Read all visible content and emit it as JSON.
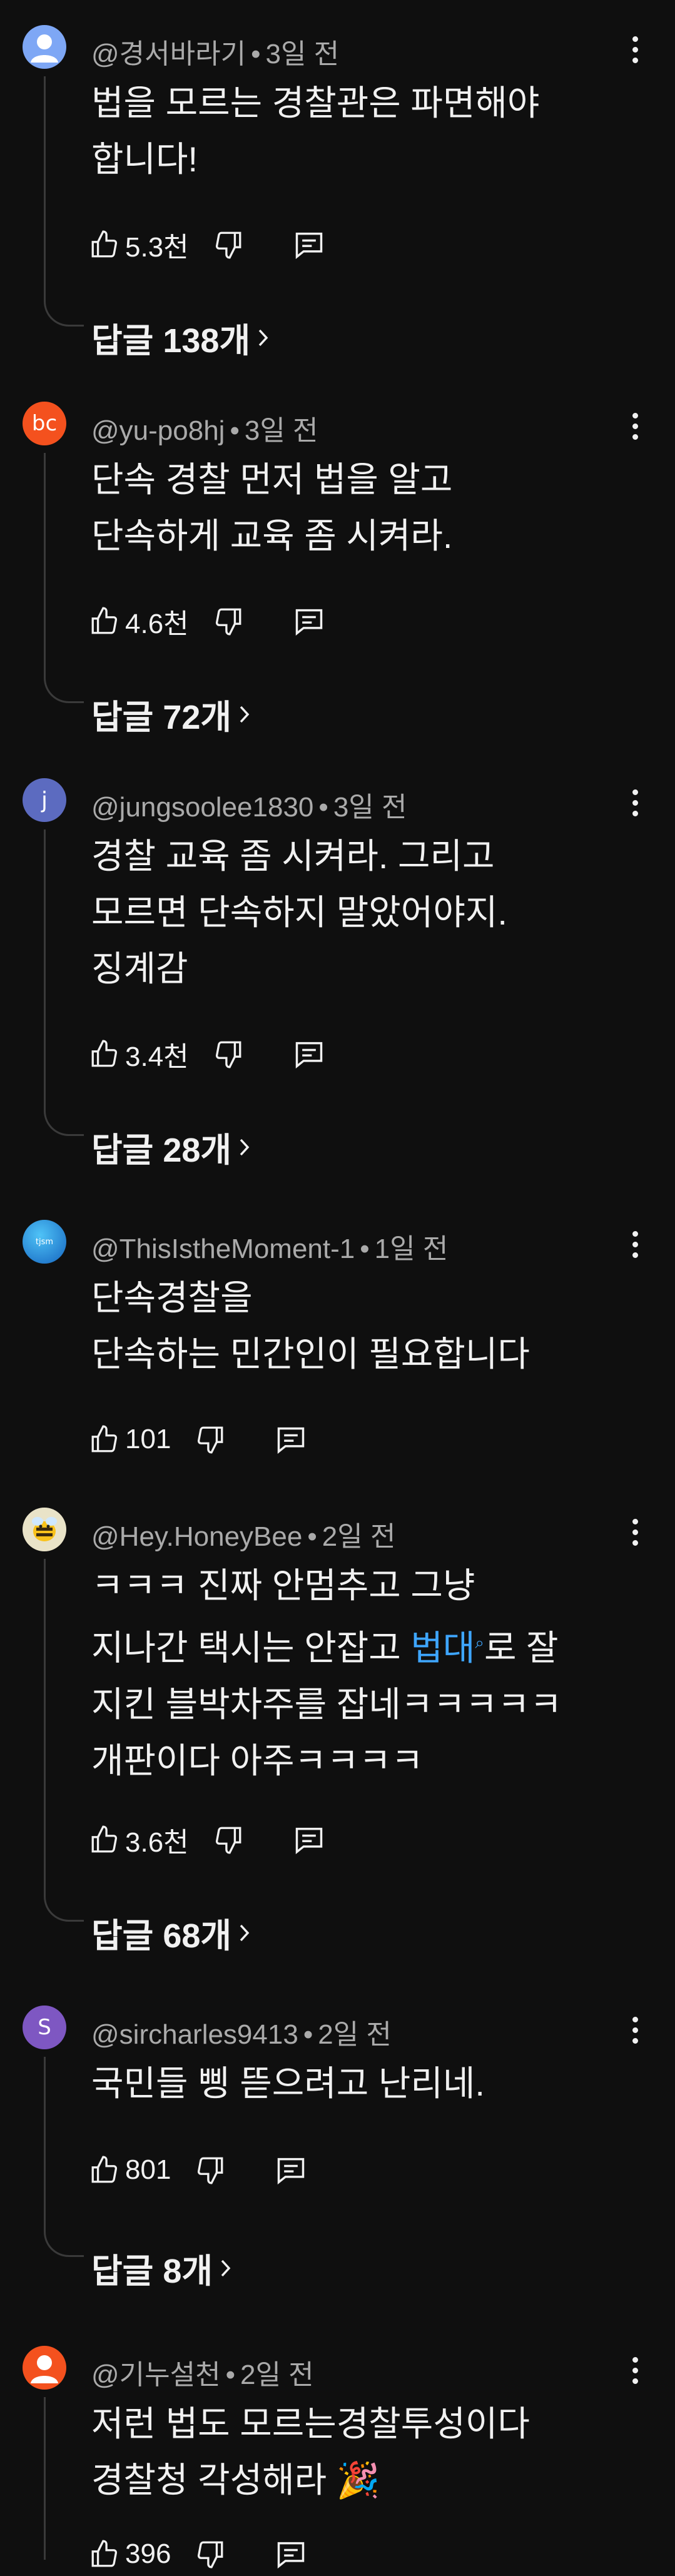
{
  "comments": [
    {
      "author": "@경서바라기",
      "time": "3일 전",
      "avatar_text": "",
      "avatar_color": "#7ea7f5",
      "avatar_kind": "person",
      "lines": [
        "법을 모르는 경찰관은 파면해야",
        "합니다!"
      ],
      "likes": "5.3천",
      "replies": "답글 138개"
    },
    {
      "author": "@yu-po8hj",
      "time": "3일 전",
      "avatar_text": "bc",
      "avatar_color": "#f4511e",
      "avatar_kind": "text",
      "lines": [
        "단속 경찰 먼저 법을 알고",
        "단속하게 교육 좀 시켜라."
      ],
      "likes": "4.6천",
      "replies": "답글 72개"
    },
    {
      "author": "@jungsoolee1830",
      "time": "3일 전",
      "avatar_text": "j",
      "avatar_color": "#5c6bc0",
      "avatar_kind": "text",
      "lines": [
        "경찰 교육 좀 시켜라. 그리고",
        "모르면 단속하지 말았어야지.",
        "징계감"
      ],
      "likes": "3.4천",
      "replies": "답글 28개"
    },
    {
      "author": "@ThisIstheMoment-1",
      "time": "1일 전",
      "avatar_text": "tjsm",
      "avatar_color": "#1e88b5",
      "avatar_kind": "text-small",
      "lines": [
        "단속경찰을",
        "단속하는 민간인이 필요합니다"
      ],
      "likes": "101",
      "replies": ""
    },
    {
      "author": "@Hey.HoneyBee",
      "time": "2일 전",
      "avatar_text": "",
      "avatar_color": "#e9e3c8",
      "avatar_kind": "bee",
      "lines": [
        "ㅋㅋㅋ 진짜 안멈추고 그냥",
        "지나간 택시는 안잡고 |법대|로 잘",
        "지킨 블박차주를 잡네ㅋㅋㅋㅋㅋ",
        "개판이다 아주ㅋㅋㅋㅋ"
      ],
      "link_text": "법대",
      "likes": "3.6천",
      "replies": "답글 68개"
    },
    {
      "author": "@sircharles9413",
      "time": "2일 전",
      "avatar_text": "S",
      "avatar_color": "#7e57c2",
      "avatar_kind": "text",
      "lines": [
        "국민들 삥 뜯으려고 난리네."
      ],
      "likes": "801",
      "replies": "답글 8개"
    },
    {
      "author": "@기누설천",
      "time": "2일 전",
      "avatar_text": "",
      "avatar_color": "#f4511e",
      "avatar_kind": "person",
      "lines": [
        "저런 법도 모르는경찰투성이다",
        "경찰청 각성해라 🎉"
      ],
      "likes": "396",
      "replies": ""
    }
  ]
}
